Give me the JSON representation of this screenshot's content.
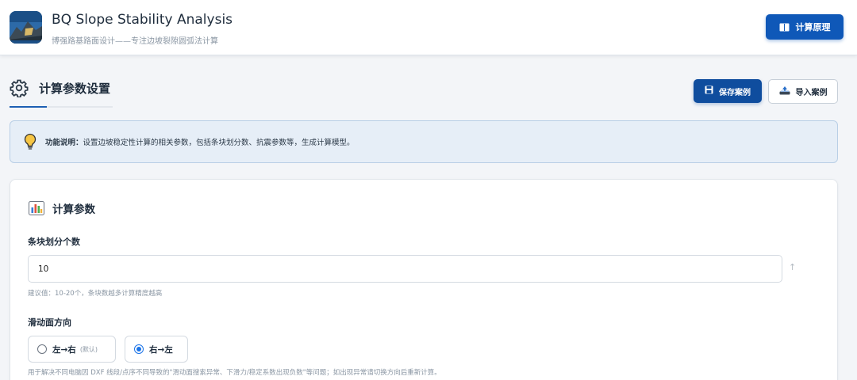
{
  "header": {
    "title": "BQ Slope Stability Analysis",
    "subtitle": "博强路基路面设计——专注边坡裂隙圆弧法计算",
    "principle_button": "计算原理",
    "logo_icon": "mountain-logo-icon",
    "principle_icon": "book-icon"
  },
  "section": {
    "title": "计算参数设置",
    "icon": "gear-icon",
    "save_button": "保存案例",
    "import_button": "导入案例",
    "save_icon": "floppy-icon",
    "import_icon": "import-icon"
  },
  "info": {
    "icon": "lightbulb-icon",
    "label": "功能说明：",
    "text": "设置边坡稳定性计算的相关参数，包括条块划分数、抗震参数等，生成计算模型。"
  },
  "card": {
    "icon": "bar-chart-icon",
    "title": "计算参数",
    "slices": {
      "label": "条块划分个数",
      "value": "10",
      "hint": "建议值：10-20个，条块数越多计算精度越高"
    },
    "direction": {
      "label": "滑动面方向",
      "options": [
        {
          "label": "左→右",
          "tag": "(默认)",
          "checked": false
        },
        {
          "label": "右→左",
          "tag": "",
          "checked": true
        }
      ],
      "hint": "用于解决不同电脑因 DXF 线段/点序不同导致的\"滑动面搜索异常、下滑力/稳定系数出现负数\"等问题；如出现异常请切换方向后重新计算。"
    }
  },
  "colors": {
    "primary": "#0f58b8",
    "info_bg": "#e6eef7",
    "accent_radio": "#1a73e8"
  }
}
